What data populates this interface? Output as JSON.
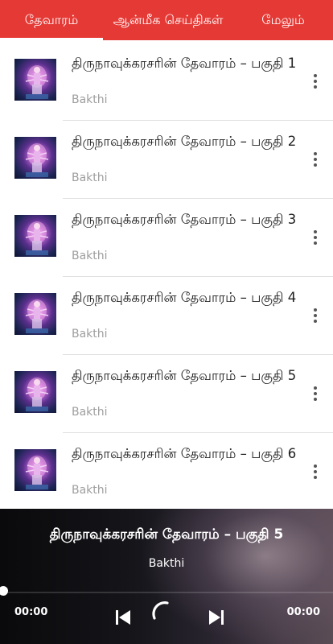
{
  "tabs": [
    {
      "label": "தேவாரம்",
      "active": true
    },
    {
      "label": "ஆன்மீக செய்திகள்",
      "active": false
    },
    {
      "label": "மேலும்",
      "active": false
    }
  ],
  "list": [
    {
      "title": "திருநாவுக்கரசரின் தேவாரம் – பகுதி 1",
      "subtitle": "Bakthi",
      "thumbnail_icon": "deity-thumbnail-icon",
      "menu_icon": "more-vert-icon"
    },
    {
      "title": "திருநாவுக்கரசரின் தேவாரம் – பகுதி 2",
      "subtitle": "Bakthi",
      "thumbnail_icon": "deity-thumbnail-icon",
      "menu_icon": "more-vert-icon"
    },
    {
      "title": "திருநாவுக்கரசரின் தேவாரம் – பகுதி 3",
      "subtitle": "Bakthi",
      "thumbnail_icon": "deity-thumbnail-icon",
      "menu_icon": "more-vert-icon"
    },
    {
      "title": "திருநாவுக்கரசரின் தேவாரம் – பகுதி 4",
      "subtitle": "Bakthi",
      "thumbnail_icon": "deity-thumbnail-icon",
      "menu_icon": "more-vert-icon"
    },
    {
      "title": "திருநாவுக்கரசரின் தேவாரம் – பகுதி 5",
      "subtitle": "Bakthi",
      "thumbnail_icon": "deity-thumbnail-icon",
      "menu_icon": "more-vert-icon"
    },
    {
      "title": "திருநாவுக்கரசரின் தேவாரம் – பகுதி 6",
      "subtitle": "Bakthi",
      "thumbnail_icon": "deity-thumbnail-icon",
      "menu_icon": "more-vert-icon"
    }
  ],
  "player": {
    "title": "திருநாவுக்கரசரின் தேவாரம் – பகுதி 5",
    "artist": "Bakthi",
    "elapsed": "00:00",
    "duration": "00:00",
    "progress": 0,
    "controls": [
      "skip-previous-icon",
      "loading-spinner-icon",
      "skip-next-icon"
    ]
  },
  "colors": {
    "tab_bar": "#e53935",
    "tab_text": "#ffffff",
    "title_text": "#202020",
    "subtitle_text": "#9e9e9e",
    "player_bg": "#15151a"
  }
}
